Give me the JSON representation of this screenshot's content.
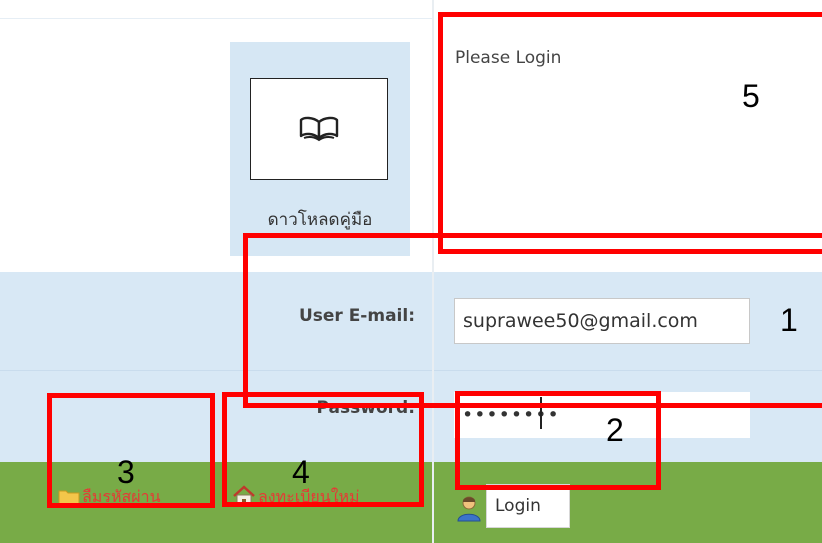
{
  "download": {
    "label": "ดาวโหลดคู่มือ",
    "icon": "open-book-icon"
  },
  "message": {
    "text": "Please Login"
  },
  "form": {
    "email_label": "User E-mail:",
    "email_value": "suprawee50@gmail.com",
    "password_label": "Password:",
    "password_value": "••••••••",
    "login_label": "Login"
  },
  "footer": {
    "forgot_label": "ลืมรหัสผ่าน",
    "register_label": "ลงทะเบียนใหม่"
  },
  "annotations": {
    "n1": "1",
    "n2": "2",
    "n3": "3",
    "n4": "4",
    "n5": "5"
  },
  "colors": {
    "panel_blue": "#d8e8f5",
    "footer_green": "#78ab47",
    "annotation_red": "#ff0000",
    "link_red": "#e53935"
  }
}
